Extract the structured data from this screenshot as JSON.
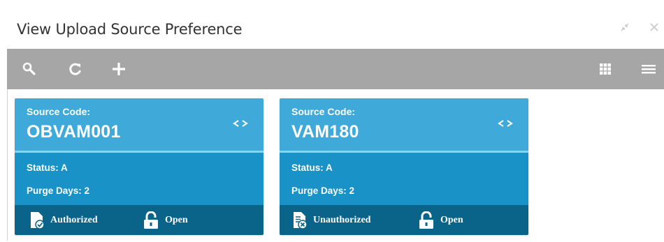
{
  "window": {
    "title": "View Upload Source Preference",
    "controls": [
      "minimize-icon",
      "close-icon"
    ]
  },
  "toolbar": {
    "left_tools": [
      "search-icon",
      "refresh-icon",
      "add-icon"
    ],
    "right_tools": [
      "grid-view-icon",
      "list-view-icon"
    ]
  },
  "cards": [
    {
      "code_label": "Source Code:",
      "code": "OBVAM001",
      "status": "Status:  A",
      "purge": "Purge Days:  2",
      "auth_label": "Authorized",
      "auth_icon": "authorized-doc-icon",
      "record_label": "Open",
      "record_icon": "lock-open-icon"
    },
    {
      "code_label": "Source Code:",
      "code": "VAM180",
      "status": "Status:  A",
      "purge": "Purge Days:  2",
      "auth_label": "Unauthorized",
      "auth_icon": "unauthorized-doc-icon",
      "record_label": "Open",
      "record_icon": "lock-open-icon"
    }
  ],
  "colors": {
    "toolbar": "#a6a6a6",
    "card_header": "#3fa9d9",
    "card_separator": "#7fd6f5",
    "card_body": "#1993c7",
    "card_footer": "#0a6489"
  }
}
